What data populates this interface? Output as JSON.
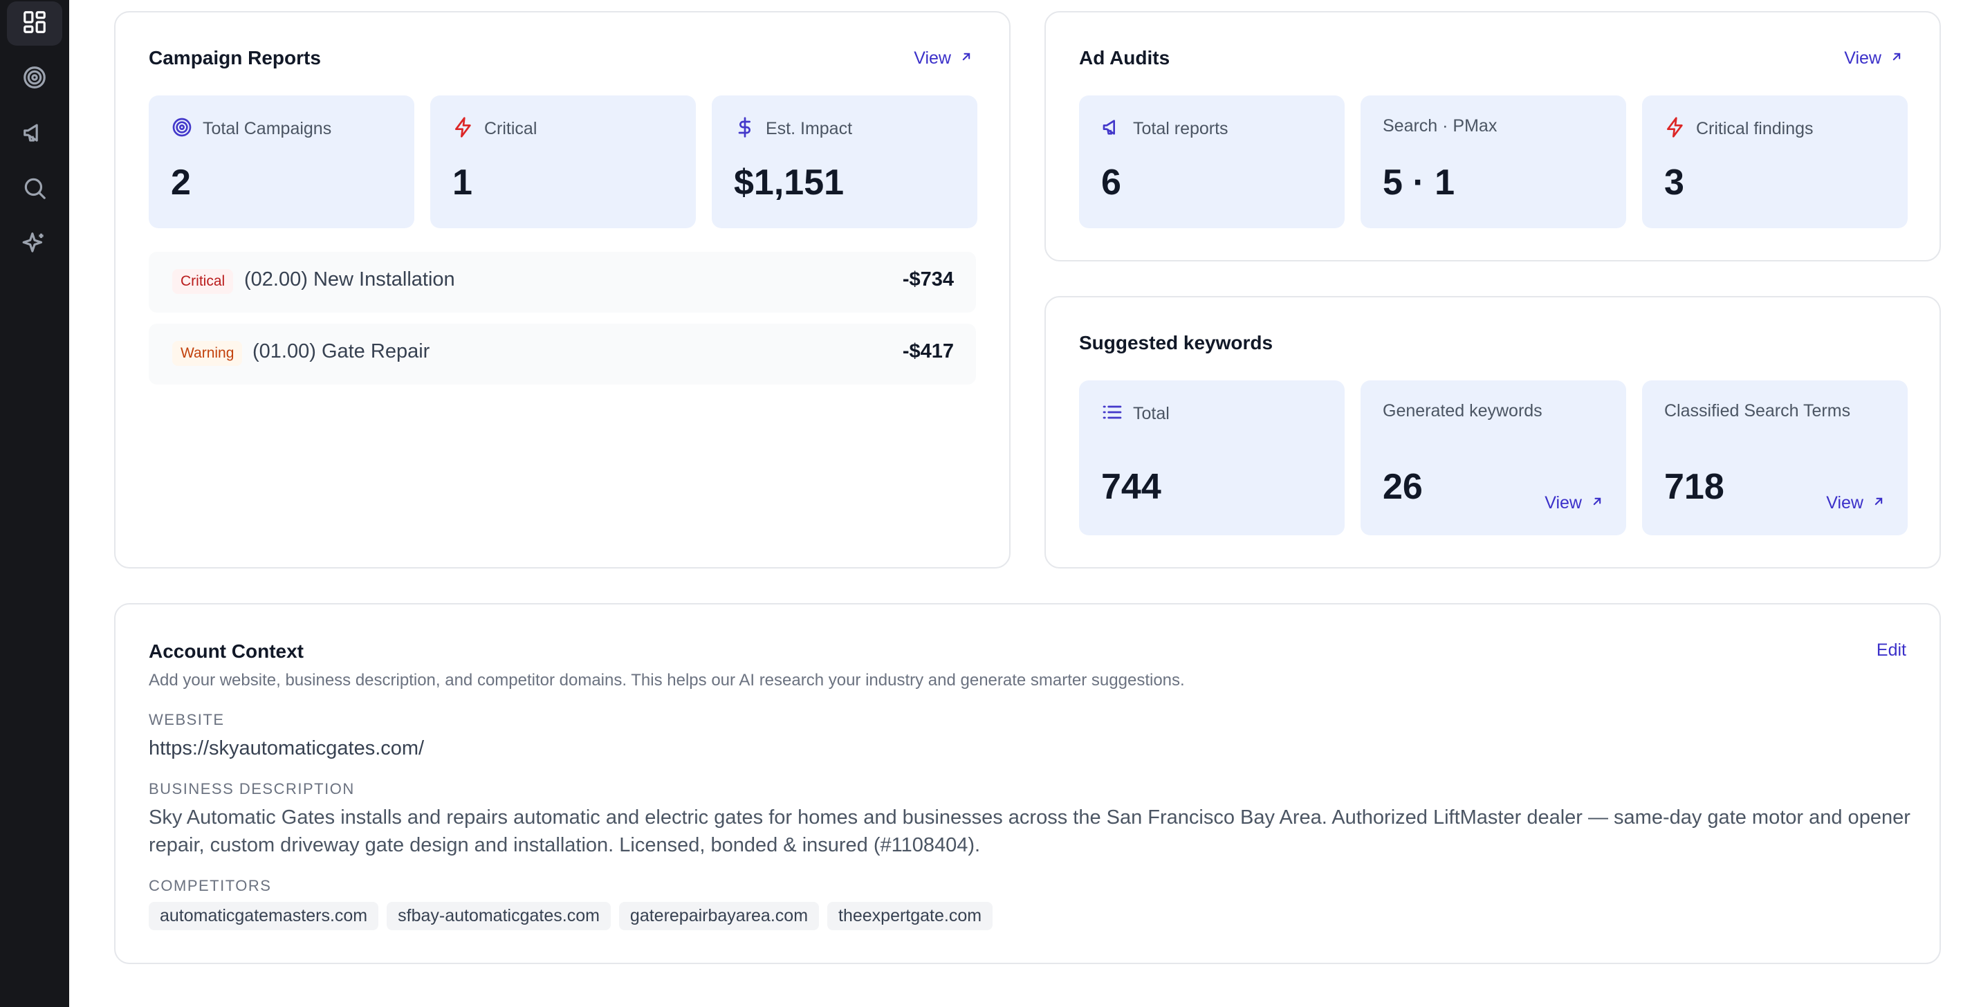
{
  "sidebar": {
    "items": [
      {
        "icon": "dashboard-grid-icon",
        "active": true
      },
      {
        "icon": "target-icon"
      },
      {
        "icon": "megaphone-icon"
      },
      {
        "icon": "search-icon"
      },
      {
        "icon": "sparkles-icon"
      }
    ]
  },
  "campaign_reports": {
    "title": "Campaign Reports",
    "view_label": "View",
    "stats": [
      {
        "label": "Total Campaigns",
        "value": "2",
        "icon": "target-icon"
      },
      {
        "label": "Critical",
        "value": "1",
        "icon": "bolt-icon"
      },
      {
        "label": "Est. Impact",
        "value": "$1,151",
        "icon": "dollar-icon"
      }
    ],
    "rows": [
      {
        "badge": "Critical",
        "name": "(02.00) New Installation",
        "amount": "-$734"
      },
      {
        "badge": "Warning",
        "name": "(01.00) Gate Repair",
        "amount": "-$417"
      }
    ]
  },
  "ad_audits": {
    "title": "Ad Audits",
    "view_label": "View",
    "stats": [
      {
        "label": "Total reports",
        "value": "6",
        "icon": "megaphone-icon"
      },
      {
        "label": "Search · PMax",
        "value": "5 · 1"
      },
      {
        "label": "Critical findings",
        "value": "3",
        "icon": "bolt-icon"
      }
    ]
  },
  "suggested_keywords": {
    "title": "Suggested keywords",
    "stats": [
      {
        "label": "Total",
        "value": "744",
        "icon": "list-icon"
      },
      {
        "label": "Generated keywords",
        "value": "26",
        "view_label": "View"
      },
      {
        "label": "Classified Search Terms",
        "value": "718",
        "view_label": "View"
      }
    ]
  },
  "account_context": {
    "title": "Account Context",
    "edit_label": "Edit",
    "description": "Add your website, business description, and competitor domains. This helps our AI research your industry and generate smarter suggestions.",
    "website_label": "WEBSITE",
    "website": "https://skyautomaticgates.com/",
    "business_label": "BUSINESS DESCRIPTION",
    "business_description": "Sky Automatic Gates installs and repairs automatic and electric gates for homes and businesses across the San Francisco Bay Area. Authorized LiftMaster dealer — same-day gate motor and opener repair, custom driveway gate design and installation. Licensed, bonded & insured (#1108404).",
    "competitors_label": "COMPETITORS",
    "competitors": [
      "automaticgatemasters.com",
      "sfbay-automaticgates.com",
      "gaterepairbayarea.com",
      "theexpertgate.com"
    ]
  },
  "colors": {
    "sidebar_bg": "#16171b",
    "accent": "#3b30c9",
    "stat_bg": "#ebf1fd",
    "critical": "#dc2626",
    "warning": "#c2410c"
  }
}
